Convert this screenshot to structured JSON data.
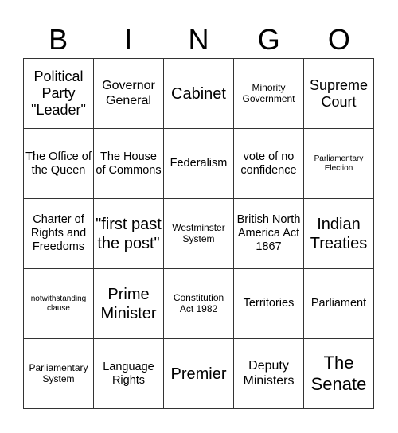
{
  "header": {
    "letters": [
      "B",
      "I",
      "N",
      "G",
      "O"
    ]
  },
  "grid": {
    "rows": [
      [
        "Political Party \"Leader\"",
        "Governor General",
        "Cabinet",
        "Minority Government",
        "Supreme Court"
      ],
      [
        "The Office of the Queen",
        "The House of Commons",
        "Federalism",
        "vote of no confidence",
        "Parliamentary Election"
      ],
      [
        "Charter of Rights and Freedoms",
        "\"first past the post\"",
        "Westminster System",
        "British North America Act 1867",
        "Indian Treaties"
      ],
      [
        "notwithstanding clause",
        "Prime Minister",
        "Constitution Act 1982",
        "Territories",
        "Parliament"
      ],
      [
        "Parliamentary System",
        "Language Rights",
        "Premier",
        "Deputy Ministers",
        "The Senate"
      ]
    ]
  }
}
